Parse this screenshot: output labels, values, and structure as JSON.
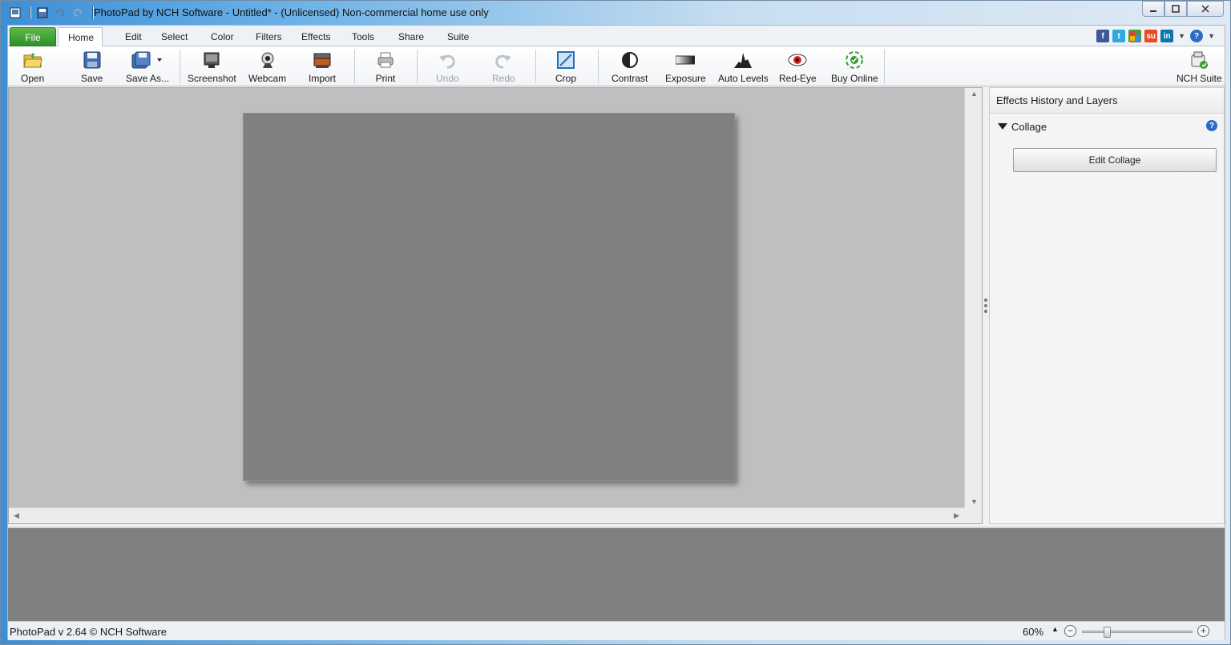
{
  "window": {
    "title": "PhotoPad by NCH Software - Untitled* - (Unlicensed) Non-commercial home use only"
  },
  "tabs": [
    {
      "label": "File"
    },
    {
      "label": "Home"
    },
    {
      "label": "Edit"
    },
    {
      "label": "Select"
    },
    {
      "label": "Color"
    },
    {
      "label": "Filters"
    },
    {
      "label": "Effects"
    },
    {
      "label": "Tools"
    },
    {
      "label": "Share"
    },
    {
      "label": "Suite"
    }
  ],
  "toolbar": {
    "open": "Open",
    "save": "Save",
    "save_as": "Save As...",
    "screenshot": "Screenshot",
    "webcam": "Webcam",
    "import": "Import",
    "print": "Print",
    "undo": "Undo",
    "redo": "Redo",
    "crop": "Crop",
    "contrast": "Contrast",
    "exposure": "Exposure",
    "auto_levels": "Auto Levels",
    "red_eye": "Red-Eye",
    "buy_online": "Buy Online",
    "nch_suite": "NCH Suite"
  },
  "social": {
    "facebook": "f",
    "twitter": "t",
    "stumbleupon": "su",
    "linkedin": "in",
    "help": "?"
  },
  "panel": {
    "title": "Effects History and Layers",
    "layer_name": "Collage",
    "edit_button": "Edit Collage",
    "help": "?"
  },
  "status": {
    "version": "PhotoPad v 2.64 © NCH Software",
    "zoom": "60%",
    "zoom_level": 0.2
  },
  "colors": {
    "file_tab": "#3a9a33",
    "canvas_bg": "#bfbfbf",
    "photo_bg": "#808080",
    "accent": "#2d6cc6"
  }
}
